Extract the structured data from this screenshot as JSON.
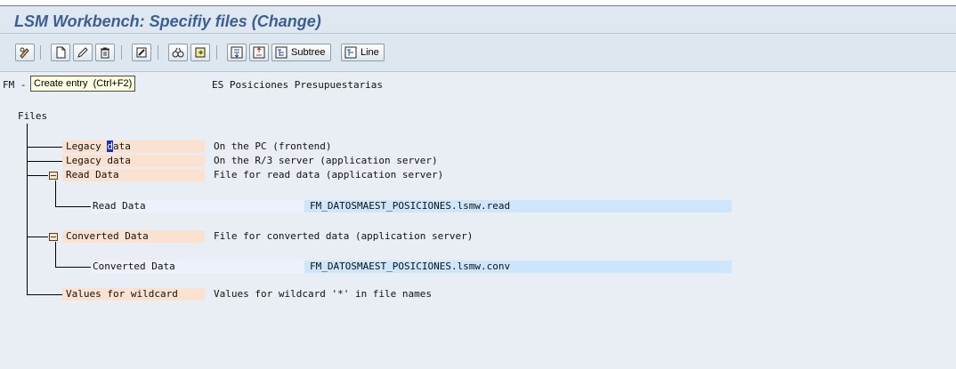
{
  "window": {
    "title": "LSM Workbench: Specifiy files (Change)"
  },
  "toolbar": {
    "subtree_label": "Subtree",
    "line_label": "Line"
  },
  "tooltip": {
    "text": "Create entry  (Ctrl+F2)"
  },
  "header": {
    "prefix": "FM - DAT",
    "suffix": "ES Posiciones Presupuestarias"
  },
  "tree": {
    "root_label": "Files",
    "nodes": [
      {
        "label_before_cursor": "Legacy ",
        "cursor_char": "d",
        "label_after_cursor": "ata",
        "desc": "On the PC (frontend)"
      },
      {
        "label": "Legacy data",
        "desc": "On the R/3 server (application server)"
      },
      {
        "label": "Read Data",
        "desc": "File for read data (application server)",
        "child": {
          "label": "Read Data",
          "value": "FM_DATOSMAEST_POSICIONES.lsmw.read"
        }
      },
      {
        "label": "Converted Data",
        "desc": "File for converted data (application server)",
        "child": {
          "label": "Converted Data",
          "value": "FM_DATOSMAEST_POSICIONES.lsmw.conv"
        }
      },
      {
        "label": "Values for wildcard",
        "desc": "Values for wildcard '*' in file names"
      }
    ]
  }
}
